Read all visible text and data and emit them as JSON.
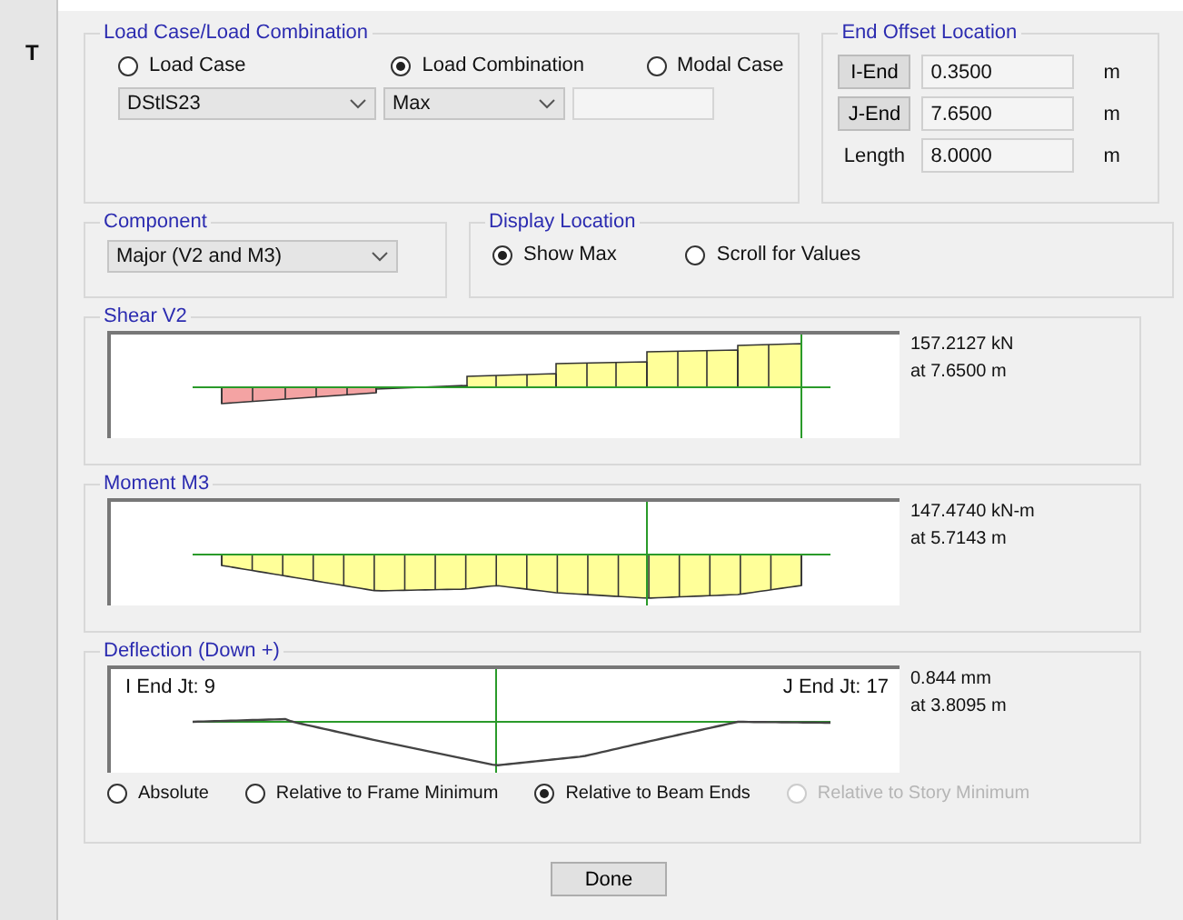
{
  "background_window": {
    "text": "T"
  },
  "load_case_group": {
    "title": "Load Case/Load Combination",
    "options": [
      {
        "label": "Load Case",
        "selected": false
      },
      {
        "label": "Load Combination",
        "selected": true
      },
      {
        "label": "Modal Case",
        "selected": false
      }
    ],
    "combination": "DStlS23",
    "envelope": "Max"
  },
  "end_offset": {
    "title": "End Offset Location",
    "rows": [
      {
        "kind": "button",
        "label": "I-End",
        "value": "0.3500",
        "unit": "m"
      },
      {
        "kind": "button",
        "label": "J-End",
        "value": "7.6500",
        "unit": "m"
      },
      {
        "kind": "text",
        "label": "Length",
        "value": "8.0000",
        "unit": "m"
      }
    ]
  },
  "component": {
    "title": "Component",
    "value": "Major (V2 and M3)"
  },
  "display_location": {
    "title": "Display Location",
    "options": [
      {
        "label": "Show Max",
        "selected": true
      },
      {
        "label": "Scroll for Values",
        "selected": false
      }
    ]
  },
  "diagrams": [
    {
      "kind": "shear",
      "title": "Shear V2",
      "value": "157.2127 kN",
      "location": "at 7.6500 m"
    },
    {
      "kind": "moment",
      "title": "Moment M3",
      "value": "147.4740 kN-m",
      "location": "at 5.7143 m"
    },
    {
      "kind": "deflection",
      "title": "Deflection (Down +)",
      "i_end": "I End Jt: 9",
      "j_end": "J End Jt: 17",
      "value": "0.844 mm",
      "location": "at 3.8095 m",
      "options": [
        {
          "label": "Absolute",
          "selected": false,
          "disabled": false
        },
        {
          "label": "Relative to Frame Minimum",
          "selected": false,
          "disabled": false
        },
        {
          "label": "Relative to Beam Ends",
          "selected": true,
          "disabled": false
        },
        {
          "label": "Relative to Story Minimum",
          "selected": false,
          "disabled": true
        }
      ]
    }
  ],
  "done_button": "Done"
}
